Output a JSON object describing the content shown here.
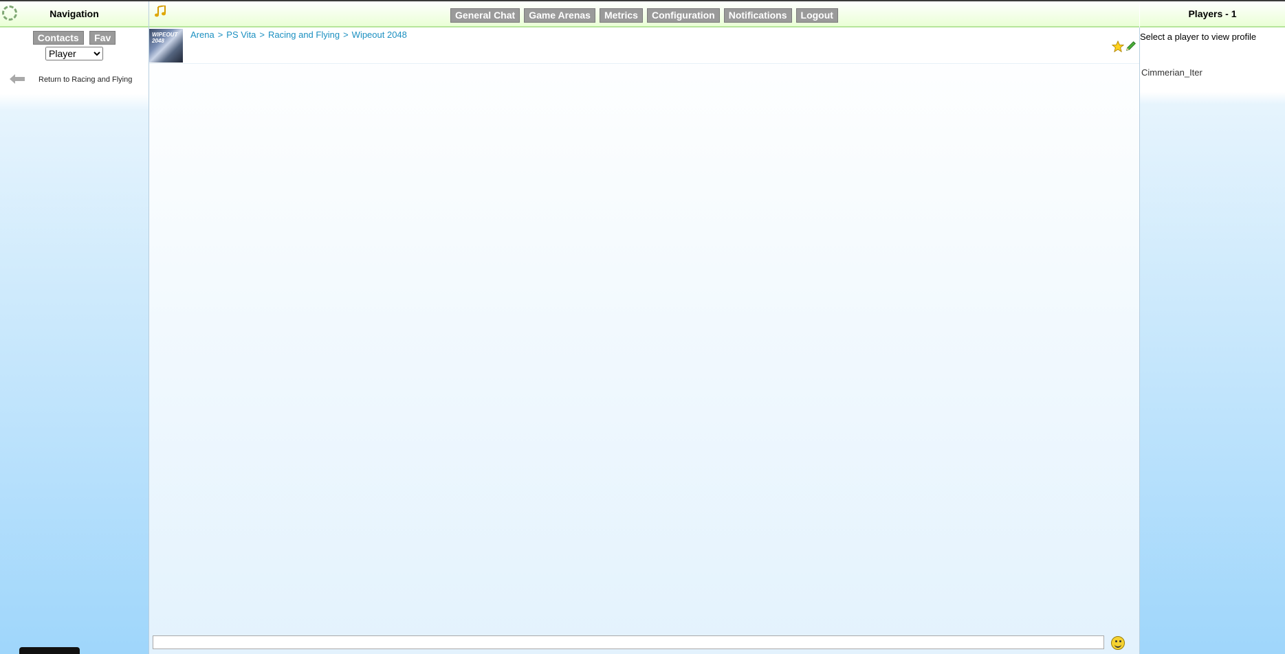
{
  "left_panel": {
    "title": "Navigation",
    "tabs": [
      "Contacts",
      "Fav"
    ],
    "select_value": "Player",
    "return_link": "Return to Racing and Flying"
  },
  "top_menu": {
    "items": [
      "General Chat",
      "Game Arenas",
      "Metrics",
      "Configuration",
      "Notifications",
      "Logout"
    ]
  },
  "arena": {
    "thumbnail_label": "WIPEOUT 2048",
    "breadcrumb": [
      "Arena",
      "PS Vita",
      "Racing and Flying",
      "Wipeout 2048"
    ],
    "breadcrumb_separator": ">"
  },
  "chat": {
    "input_value": "",
    "input_placeholder": ""
  },
  "right_panel": {
    "title": "Players - 1",
    "hint": "Select a player to view profile",
    "players": [
      "Cimmerian_Iter"
    ]
  },
  "icons": {
    "loader": "loading-spinner-icon",
    "music": "music-note-icon",
    "star": "favorite-star-icon",
    "edit": "pencil-icon",
    "smiley": "emoji-icon",
    "back": "back-arrow-icon"
  },
  "colors": {
    "header_gradient_end": "#eaffd6",
    "header_border": "#b6e59a",
    "button_gray": "#9a9a9a",
    "link_blue": "#1a8fc0",
    "sidebar_blue": "#9fd6fb"
  }
}
